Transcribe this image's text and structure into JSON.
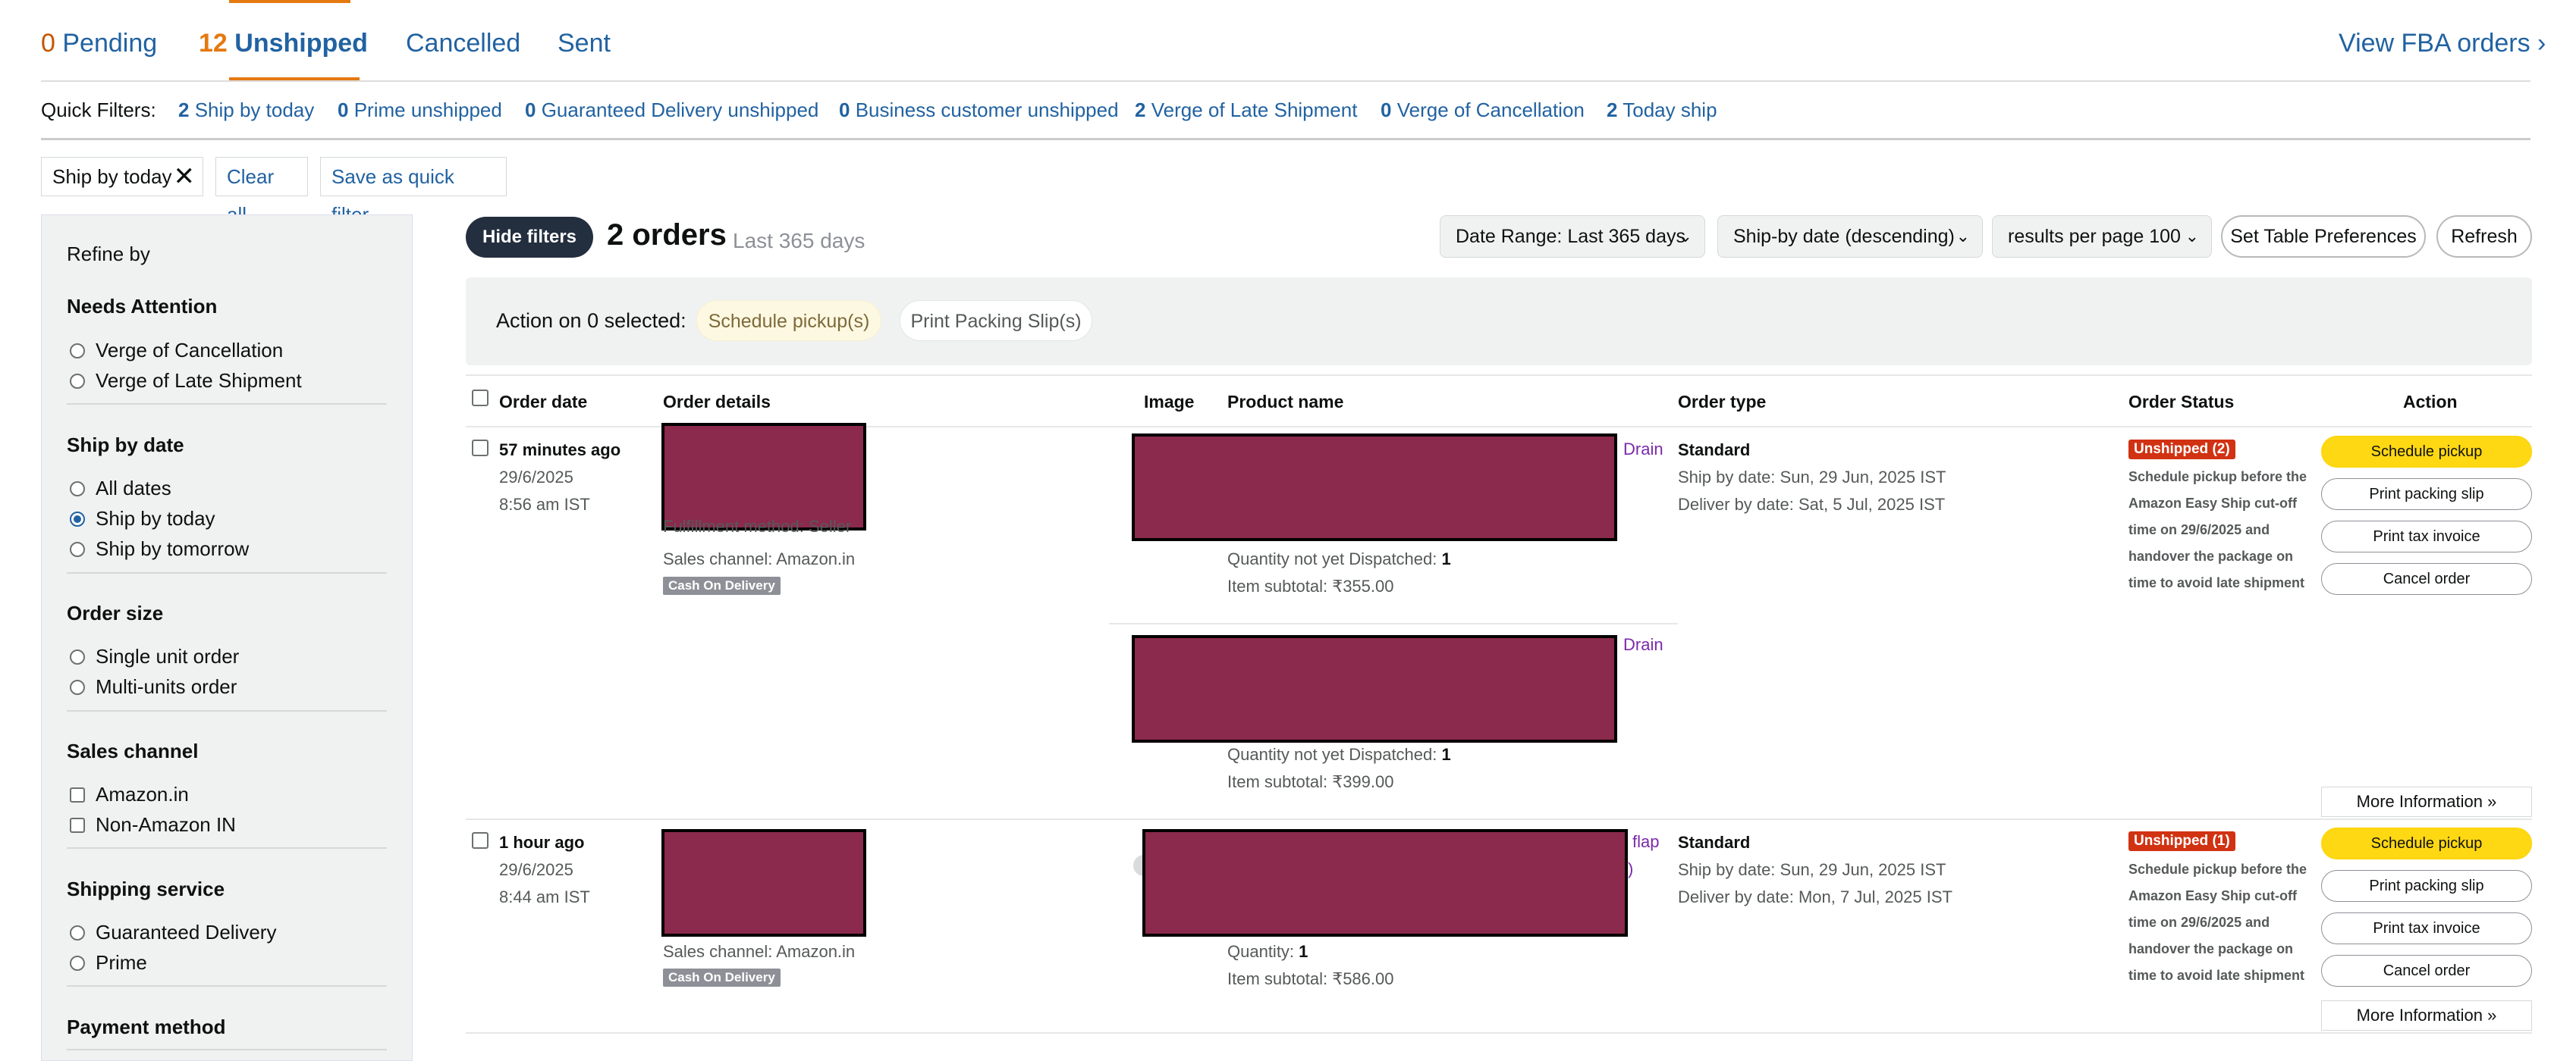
{
  "tabs": [
    {
      "count": "0",
      "name": "Pending"
    },
    {
      "count": "12",
      "name": "Unshipped"
    },
    {
      "count": "",
      "name": "Cancelled"
    },
    {
      "count": "",
      "name": "Sent"
    }
  ],
  "view_fba": "View FBA orders ›",
  "quick_filters": {
    "label": "Quick Filters:",
    "items": [
      {
        "count": "2",
        "label": "Ship by today"
      },
      {
        "count": "0",
        "label": "Prime unshipped"
      },
      {
        "count": "0",
        "label": "Guaranteed Delivery unshipped"
      },
      {
        "count": "0",
        "label": "Business customer unshipped"
      },
      {
        "count": "2",
        "label": "Verge of Late Shipment"
      },
      {
        "count": "0",
        "label": "Verge of Cancellation"
      },
      {
        "count": "2",
        "label": "Today ship"
      }
    ]
  },
  "chips": {
    "active_filter": "Ship by today",
    "clear_all": "Clear all",
    "save_quick": "Save as quick filter"
  },
  "refine": {
    "title": "Refine by",
    "needs_attention": {
      "title": "Needs Attention",
      "options": [
        "Verge of Cancellation",
        "Verge of Late Shipment"
      ]
    },
    "ship_by": {
      "title": "Ship by date",
      "options": [
        "All dates",
        "Ship by today",
        "Ship by tomorrow"
      ],
      "selected": 1
    },
    "order_size": {
      "title": "Order size",
      "options": [
        "Single unit order",
        "Multi-units order"
      ]
    },
    "sales_channel": {
      "title": "Sales channel",
      "options": [
        "Amazon.in",
        "Non-Amazon IN"
      ]
    },
    "shipping_service": {
      "title": "Shipping service",
      "options": [
        "Guaranteed Delivery",
        "Prime"
      ]
    },
    "payment_method": {
      "title": "Payment method"
    }
  },
  "results": {
    "hide_filters": "Hide filters",
    "count": "2 orders",
    "range": "Last 365 days",
    "date_range": "Date Range: Last 365 days",
    "sort": "Ship-by date (descending)",
    "per_page": "results per page 100",
    "table_prefs": "Set Table Preferences",
    "refresh": "Refresh"
  },
  "action_bar": {
    "label": "Action on 0 selected:",
    "schedule": "Schedule pickup(s)",
    "print_slip": "Print Packing Slip(s)"
  },
  "columns": [
    "Order date",
    "Order details",
    "Image",
    "Product name",
    "Order type",
    "Order Status",
    "Action"
  ],
  "orders": [
    {
      "age": "57 minutes ago",
      "date": "29/6/2025",
      "time": "8:56 am IST",
      "fulfillment": "Fulfillment method: Seller",
      "channel": "Sales channel: Amazon.in",
      "payment_badge": "Cash On Delivery",
      "items": [
        {
          "tag": "Drain",
          "qty_label": "Quantity not yet Dispatched:",
          "qty": "1",
          "subtotal_label": "Item subtotal:",
          "subtotal": "₹355.00"
        },
        {
          "tag": "Drain",
          "qty_label": "Quantity not yet Dispatched:",
          "qty": "1",
          "subtotal_label": "Item subtotal:",
          "subtotal": "₹399.00"
        }
      ],
      "type": "Standard",
      "ship_by": "Ship by date: Sun, 29 Jun, 2025 IST",
      "deliver_by": "Deliver by date: Sat, 5 Jul, 2025 IST",
      "status_badge": "Unshipped (2)",
      "status_note": "Schedule pickup before the Amazon Easy Ship cut-off time on 29/6/2025 and handover the package on time to avoid late shipment",
      "actions": [
        "Schedule pickup",
        "Print packing slip",
        "Print tax invoice",
        "Cancel order"
      ],
      "more_info": "More Information »"
    },
    {
      "age": "1 hour ago",
      "date": "29/6/2025",
      "time": "8:44 am IST",
      "channel": "Sales channel: Amazon.in",
      "payment_badge": "Cash On Delivery",
      "items": [
        {
          "tag": "flap",
          "tag2": ")",
          "qty_label": "Quantity:",
          "qty": "1",
          "subtotal_label": "Item subtotal:",
          "subtotal": "₹586.00"
        }
      ],
      "type": "Standard",
      "ship_by": "Ship by date: Sun, 29 Jun, 2025 IST",
      "deliver_by": "Deliver by date: Mon, 7 Jul, 2025 IST",
      "status_badge": "Unshipped (1)",
      "status_note": "Schedule pickup before the Amazon Easy Ship cut-off time on 29/6/2025 and handover the package on time to avoid late shipment",
      "actions": [
        "Schedule pickup",
        "Print packing slip",
        "Print tax invoice",
        "Cancel order"
      ],
      "more_info": "More Information »"
    }
  ],
  "colors": {
    "link": "#2162a1",
    "accent": "#e47911",
    "redacted": "#8b2a4c",
    "cta": "#ffd814"
  }
}
